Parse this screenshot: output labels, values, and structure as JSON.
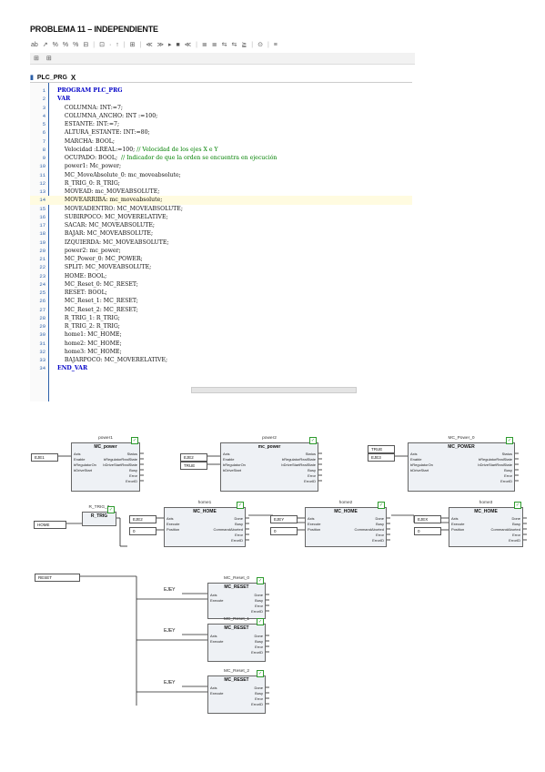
{
  "title": "PROBLEMA 11 – INDEPENDIENTE",
  "toolbar": [
    "ab",
    "↗",
    "%",
    "%",
    "%",
    "⊟",
    "|",
    "⊡",
    "·",
    "↑",
    "|",
    "⊞",
    "|",
    "≪",
    "≫",
    "▸",
    "■",
    "≪",
    "|",
    "≣",
    "≣",
    "⇆",
    "⇆",
    "≧",
    "|",
    "⊙",
    "|",
    "≡"
  ],
  "editor_tab": {
    "icon": "▮",
    "label": "PLC_PRG",
    "close": "X"
  },
  "code_lines": [
    {
      "n": "1",
      "t": "PROGRAM PLC_PRG",
      "cls": "kw"
    },
    {
      "n": "2",
      "t": "VAR",
      "cls": "kw"
    },
    {
      "n": "3",
      "t": "    COLUMNA: INT:=7;"
    },
    {
      "n": "4",
      "t": "    COLUMNA_ANCHO: INT :=100;"
    },
    {
      "n": "5",
      "t": "    ESTANTE: INT:=7;"
    },
    {
      "n": "6",
      "t": "    ALTURA_ESTANTE: INT:=80;"
    },
    {
      "n": "7",
      "t": "    MARCHA: BOOL;"
    },
    {
      "n": "8",
      "t": "    Velocidad :LREAL:=100; // Velocidad de los ejes X e Y"
    },
    {
      "n": "9",
      "t": "    OCUPADO: BOOL;  // Indicador de que la orden se encuentra en ejecución"
    },
    {
      "n": "10",
      "t": "    power1: Mc_power;"
    },
    {
      "n": "11",
      "t": "    MC_MoveAbsolute_0: mc_moveabsolute;"
    },
    {
      "n": "12",
      "t": "    R_TRIG_0: R_TRIG;"
    },
    {
      "n": "13",
      "t": "    MOVEAD: mc_MOVEABSOLUTE;"
    },
    {
      "n": "14",
      "t": "    MOVEARRIBA: mc_moveabsolute;",
      "hl": true
    },
    {
      "n": "15",
      "t": "    MOVEADENTRO: MC_MOVEABSOLUTE;"
    },
    {
      "n": "16",
      "t": "    SUBIRPOCO: MC_MOVERELATIVE;"
    },
    {
      "n": "17",
      "t": "    SACAR: MC_MOVEABSOLUTE;"
    },
    {
      "n": "18",
      "t": "    BAJAR: MC_MOVEABSOLUTE;"
    },
    {
      "n": "19",
      "t": "    IZQUIERDA: MC_MOVEABSOLUTE;"
    },
    {
      "n": "20",
      "t": "    power2: mc_power;"
    },
    {
      "n": "21",
      "t": "    MC_Power_0: MC_POWER;"
    },
    {
      "n": "22",
      "t": "    SPLIT: MC_MOVEABSOLUTE;"
    },
    {
      "n": "23",
      "t": "    HOME: BOOL;"
    },
    {
      "n": "24",
      "t": "    MC_Reset_0: MC_RESET;"
    },
    {
      "n": "25",
      "t": "    RESET: BOOL;"
    },
    {
      "n": "26",
      "t": "    MC_Reset_1: MC_RESET;"
    },
    {
      "n": "27",
      "t": "    MC_Reset_2: MC_RESET;"
    },
    {
      "n": "28",
      "t": "    R_TRIG_1: R_TRIG;"
    },
    {
      "n": "29",
      "t": "    R_TRIG_2: R_TRIG;"
    },
    {
      "n": "30",
      "t": "    home1: MC_HOME;"
    },
    {
      "n": "31",
      "t": "    home2: MC_HOME;"
    },
    {
      "n": "32",
      "t": "    home3: MC_HOME;"
    },
    {
      "n": "33",
      "t": "    BAJARPOCO: MC_MOVERELATIVE;"
    },
    {
      "n": "34",
      "t": "END_VAR",
      "cls": "kw"
    }
  ],
  "ladder": {
    "power_blocks": [
      {
        "inst": "power1",
        "type": "MC_power",
        "in_var": "EJE1",
        "in_var2": "",
        "enable": "",
        "left": [
          "Axis",
          "Enable",
          "bRegulatorOn",
          "bDriveStart"
        ],
        "right": [
          "Status",
          "bRegulatorRealState",
          "bDriveStartRealState",
          "Busy",
          "Error",
          "ErrorID"
        ]
      },
      {
        "inst": "power2",
        "type": "mc_power",
        "in_var": "EJE2",
        "in_var2": "",
        "enable": "TRUE",
        "left": [
          "Axis",
          "Enable",
          "bRegulatorOn",
          "bDriveStart"
        ],
        "right": [
          "Status",
          "bRegulatorRealState",
          "bDriveStartRealState",
          "Busy",
          "Error",
          "ErrorID"
        ]
      },
      {
        "inst": "MC_Power_0",
        "type": "MC_POWER",
        "in_var": "EJE3",
        "in_var2": "TRUE",
        "enable": "",
        "left": [
          "Axis",
          "Enable",
          "bRegulatorOn",
          "bDriveStart"
        ],
        "right": [
          "Status",
          "bRegulatorRealState",
          "bDriveStartRealState",
          "Busy",
          "Error",
          "ErrorID"
        ]
      }
    ],
    "trig": {
      "inst": "R_TRIG_0",
      "type": "R_TRIG",
      "input": "HOME"
    },
    "home_blocks": [
      {
        "inst": "home1",
        "type": "MC_HOME",
        "axis": "EJE2",
        "pos": "0",
        "left": [
          "Axis",
          "Execute",
          "Position"
        ],
        "right": [
          "Done",
          "Busy",
          "CommandAborted",
          "Error",
          "ErrorID"
        ]
      },
      {
        "inst": "home2",
        "type": "MC_HOME",
        "axis": "EJEY",
        "pos": "0",
        "left": [
          "Axis",
          "Execute",
          "Position"
        ],
        "right": [
          "Done",
          "Busy",
          "CommandAborted",
          "Error",
          "ErrorID"
        ]
      },
      {
        "inst": "home3",
        "type": "MC_HOME",
        "axis": "EJEX",
        "pos": "0",
        "left": [
          "Axis",
          "Execute",
          "Position"
        ],
        "right": [
          "Done",
          "Busy",
          "CommandAborted",
          "Error",
          "ErrorID"
        ]
      }
    ],
    "reset_input": "RESET",
    "reset_blocks": [
      {
        "inst": "MC_Reset_0",
        "type": "MC_RESET",
        "axis": "EJEY",
        "left": [
          "Axis",
          "Execute"
        ],
        "right": [
          "Done",
          "Busy",
          "Error",
          "ErrorID"
        ]
      },
      {
        "inst": "MC_Reset_1",
        "type": "MC_RESET",
        "axis": "EJEY",
        "left": [
          "Axis",
          "Execute"
        ],
        "right": [
          "Done",
          "Busy",
          "Error",
          "ErrorID"
        ]
      },
      {
        "inst": "MC_Reset_2",
        "type": "MC_RESET",
        "axis": "EJEY",
        "left": [
          "Axis",
          "Execute"
        ],
        "right": [
          "Done",
          "Busy",
          "Error",
          "ErrorID"
        ]
      }
    ]
  }
}
